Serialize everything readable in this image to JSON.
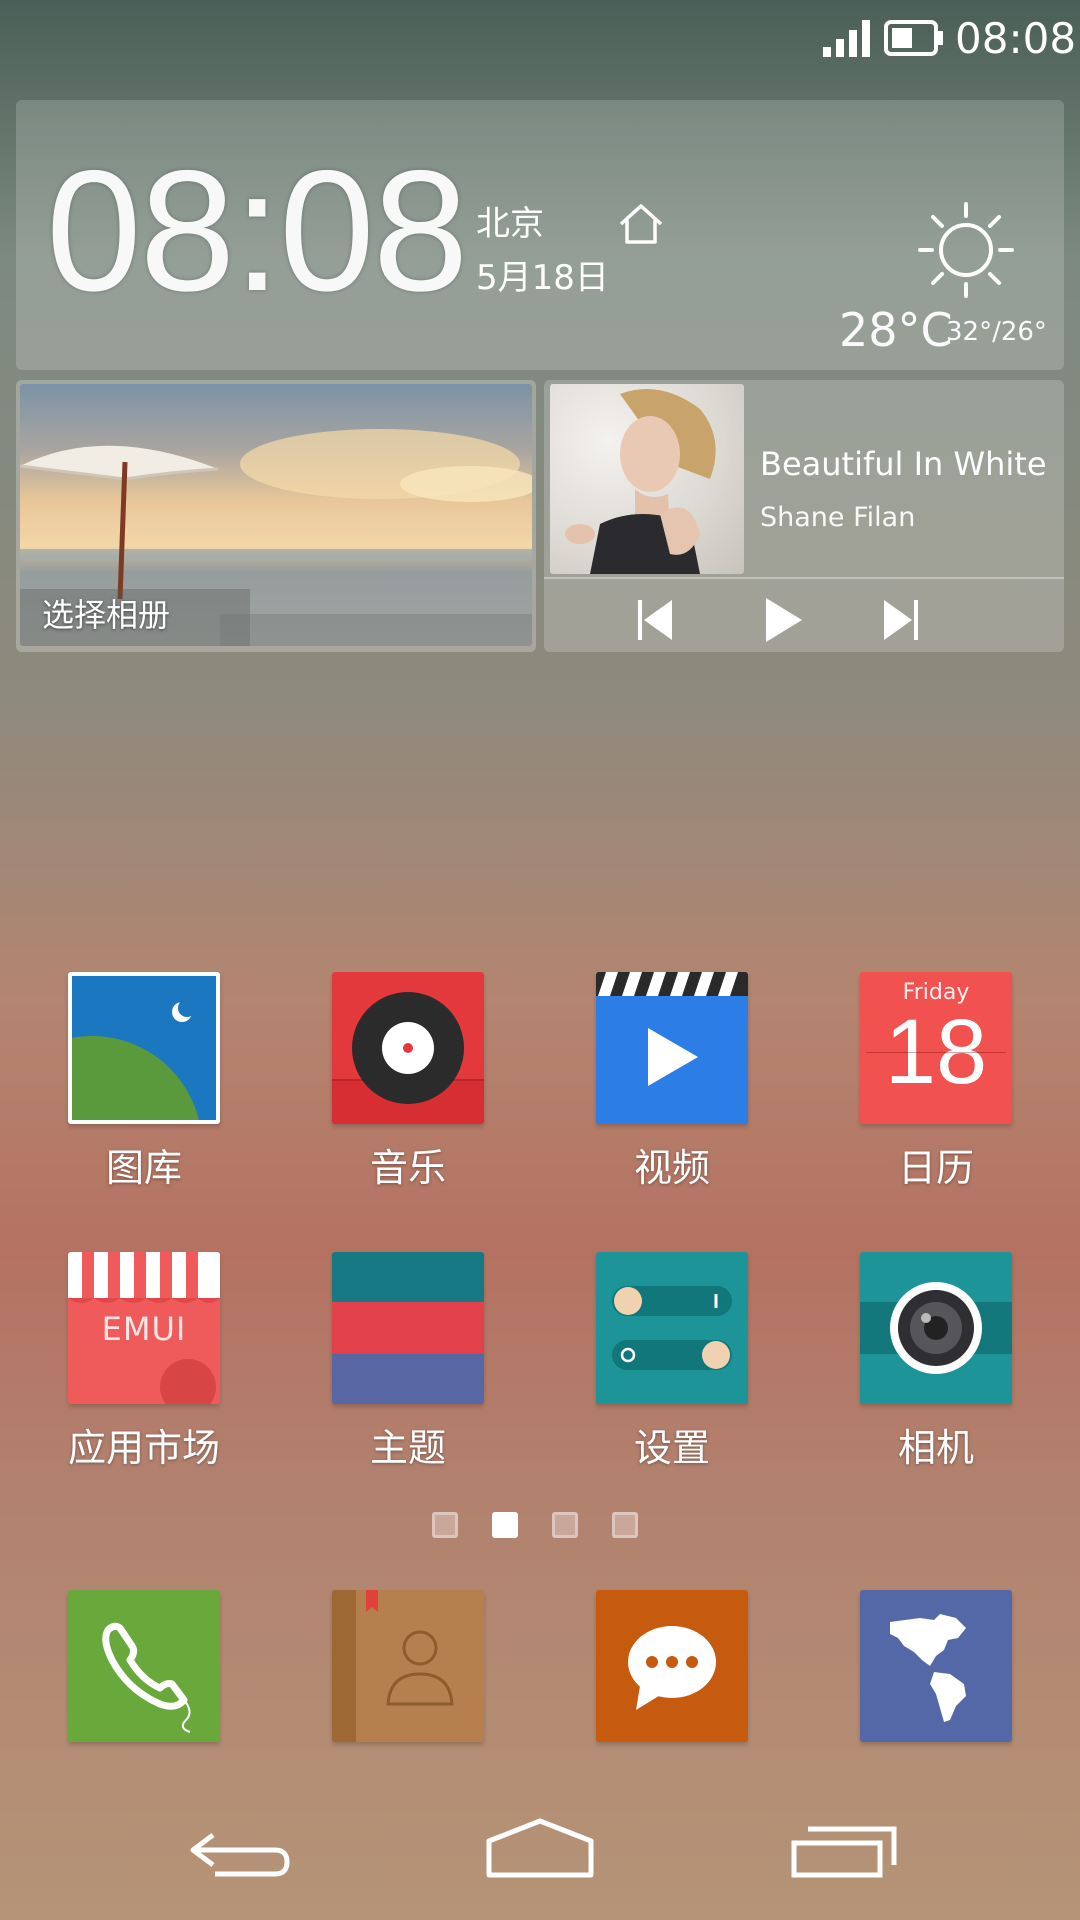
{
  "status_bar": {
    "time": "08:08"
  },
  "clock_widget": {
    "time": "08:08",
    "city": "北京",
    "date": "5月18日",
    "temperature": "28°C",
    "temp_range": "32°/26°"
  },
  "album_widget": {
    "label": "选择相册"
  },
  "music_widget": {
    "title": "Beautiful In White",
    "artist": "Shane Filan"
  },
  "apps": [
    {
      "label": "图库",
      "icon": "gallery-icon"
    },
    {
      "label": "音乐",
      "icon": "music-icon"
    },
    {
      "label": "视频",
      "icon": "video-icon"
    },
    {
      "label": "日历",
      "icon": "calendar-icon",
      "day_name": "Friday",
      "day_number": "18"
    },
    {
      "label": "应用市场",
      "icon": "app-market-icon",
      "brand": "EMUI"
    },
    {
      "label": "主题",
      "icon": "themes-icon"
    },
    {
      "label": "设置",
      "icon": "settings-icon"
    },
    {
      "label": "相机",
      "icon": "camera-icon"
    }
  ],
  "page_indicator": {
    "pages": 4,
    "current": 2
  },
  "dock": [
    "phone-icon",
    "contacts-icon",
    "messages-icon",
    "browser-icon"
  ],
  "colors": {
    "calendar_red": "#f2524f",
    "music_red": "#e3383c",
    "video_blue": "#2d7de6",
    "teal": "#1d9598",
    "phone_green": "#69a83a",
    "contacts_brown": "#a87645",
    "messages_orange": "#c65a0f",
    "browser_blue": "#5467a6"
  }
}
